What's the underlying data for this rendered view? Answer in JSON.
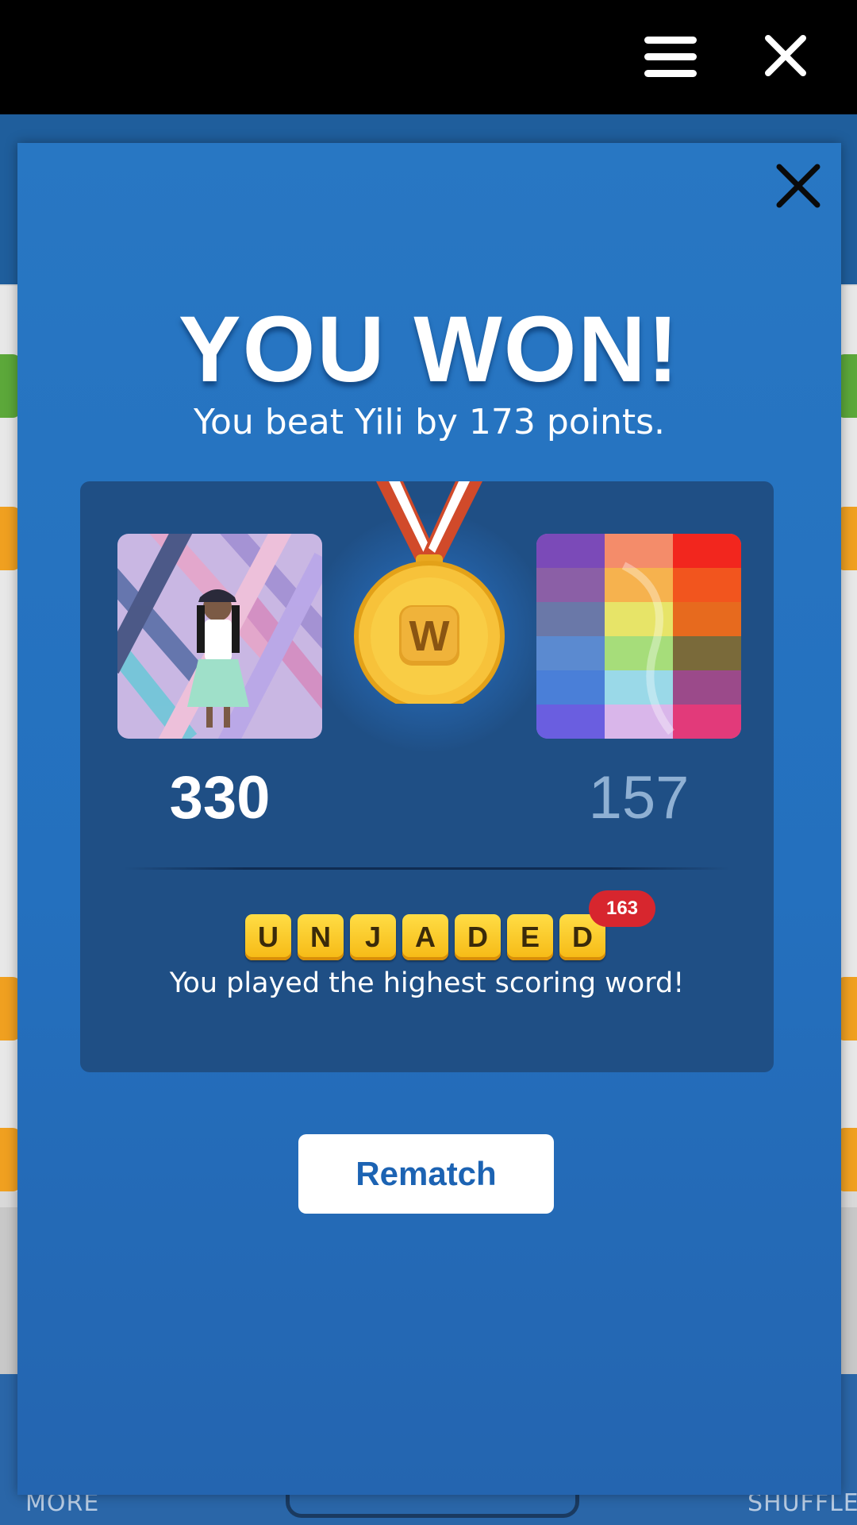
{
  "modal": {
    "title": "YOU WON!",
    "subtitle": "You beat Yili by 173 points.",
    "player_score": "330",
    "opponent_score": "157",
    "word_letters": [
      "U",
      "N",
      "J",
      "A",
      "D",
      "E",
      "D"
    ],
    "word_points": "163",
    "highest_word_text": "You played the highest scoring word!",
    "medal_letter": "W",
    "rematch_label": "Rematch"
  },
  "bottom_bar": {
    "more_label": "MORE",
    "shuffle_label": "SHUFFLE"
  },
  "colors": {
    "modal_bg": "#2877c3",
    "card_bg": "#1f4f85",
    "tile_yellow": "#f6b914",
    "badge_red": "#d7262e",
    "button_text": "#1c63b3"
  },
  "icons": [
    "menu-icon",
    "close-icon",
    "medal-icon"
  ]
}
